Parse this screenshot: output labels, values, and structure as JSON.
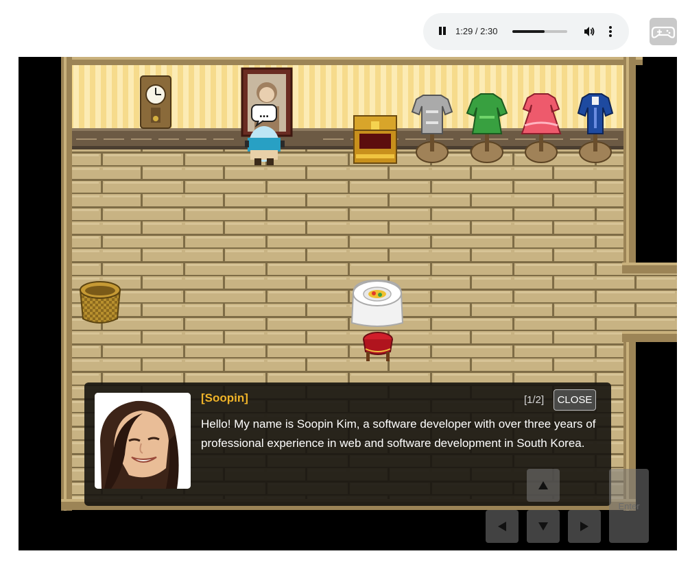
{
  "audio": {
    "time": "1:29 / 2:30",
    "progress": 0.593,
    "icons": {
      "play_state": "pause-icon",
      "volume": "volume-icon",
      "more": "more-options-icon"
    }
  },
  "gamepad_toggle": {
    "icon": "gamepad-icon"
  },
  "scene": {
    "npc_bubble": "…",
    "mannequins": [
      "armor-mannequin",
      "green-dress-mannequin",
      "pink-dress-mannequin",
      "blue-coat-mannequin"
    ]
  },
  "dialog": {
    "speaker": "[Soopin]",
    "page": "[1/2]",
    "close_label": "CLOSE",
    "message": "Hello! My name is Soopin Kim, a software developer with over three years of professional experience in web and software development in South Korea."
  },
  "controls": {
    "enter_label": "Enter"
  },
  "colors": {
    "speaker_name": "#f0b429",
    "dialog_bg": "#161410",
    "wall_stripe": "#f9e5a0"
  }
}
